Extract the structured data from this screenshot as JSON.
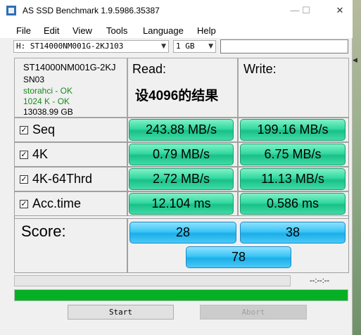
{
  "window": {
    "title": "AS SSD Benchmark 1.9.5986.35387",
    "controls": {
      "minimize": "—",
      "maximize": "☐",
      "close": "✕"
    }
  },
  "menu": [
    "File",
    "Edit",
    "View",
    "Tools",
    "Language",
    "Help"
  ],
  "toolbar": {
    "drive": "H: ST14000NM001G-2KJ103",
    "size": "1 GB",
    "notes": ""
  },
  "drive_info": {
    "model": "ST14000NM001G-2KJ",
    "firmware": "SN03",
    "driver": "storahci - OK",
    "alignment": "1024 K - OK",
    "capacity": "13038.99 GB"
  },
  "headers": {
    "read": "Read:",
    "write": "Write:"
  },
  "annotation": "设4096的结果",
  "check_mark": "✓",
  "tests": [
    {
      "label": "Seq",
      "read": "243.88 MB/s",
      "write": "199.16 MB/s"
    },
    {
      "label": "4K",
      "read": "0.79 MB/s",
      "write": "6.75 MB/s"
    },
    {
      "label": "4K-64Thrd",
      "read": "2.72 MB/s",
      "write": "11.13 MB/s"
    },
    {
      "label": "Acc.time",
      "read": "12.104 ms",
      "write": "0.586 ms"
    }
  ],
  "score": {
    "label": "Score:",
    "read": "28",
    "write": "38",
    "total": "78"
  },
  "progress": {
    "elapsed": "--:--:--",
    "main_fraction": 1.0
  },
  "buttons": {
    "start": "Start",
    "abort": "Abort"
  },
  "colors": {
    "result_green": "#34d8a0",
    "score_blue": "#3bc5f5",
    "progress_green": "#06b025"
  }
}
